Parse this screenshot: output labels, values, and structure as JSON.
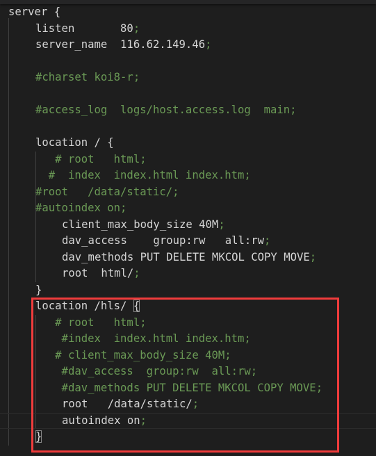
{
  "editor": {
    "language": "nginx",
    "lines": [
      {
        "indent": 0,
        "text": "server {",
        "type": "code"
      },
      {
        "indent": 1,
        "text": "listen       80;",
        "type": "code"
      },
      {
        "indent": 1,
        "text": "server_name  116.62.149.46;",
        "type": "code"
      },
      {
        "indent": 1,
        "text": "",
        "type": "blank"
      },
      {
        "indent": 1,
        "text": "#charset koi8-r;",
        "type": "comment"
      },
      {
        "indent": 1,
        "text": "",
        "type": "blank"
      },
      {
        "indent": 1,
        "text": "#access_log  logs/host.access.log  main;",
        "type": "comment"
      },
      {
        "indent": 1,
        "text": "",
        "type": "blank"
      },
      {
        "indent": 1,
        "text": "location / {",
        "type": "code"
      },
      {
        "indent": 1,
        "text": "   # root   html;",
        "type": "comment"
      },
      {
        "indent": 1,
        "text": "  #  index  index.html index.htm;",
        "type": "comment"
      },
      {
        "indent": 1,
        "text": "#root   /data/static/;",
        "type": "comment"
      },
      {
        "indent": 1,
        "text": "#autoindex on;",
        "type": "comment"
      },
      {
        "indent": 2,
        "text": "client_max_body_size 40M;",
        "type": "code"
      },
      {
        "indent": 2,
        "text": "dav_access    group:rw   all:rw;",
        "type": "code"
      },
      {
        "indent": 2,
        "text": "dav_methods PUT DELETE MKCOL COPY MOVE;",
        "type": "code"
      },
      {
        "indent": 2,
        "text": "root  html/;",
        "type": "code"
      },
      {
        "indent": 1,
        "text": "}",
        "type": "code"
      },
      {
        "indent": 1,
        "text": "location /hls/ {",
        "type": "code"
      },
      {
        "indent": 1,
        "text": "   # root   html;",
        "type": "comment"
      },
      {
        "indent": 1,
        "text": "    #index  index.html index.htm;",
        "type": "comment"
      },
      {
        "indent": 1,
        "text": "   # client_max_body_size 40M;",
        "type": "comment"
      },
      {
        "indent": 1,
        "text": "    #dav_access  group:rw  all:rw;",
        "type": "comment"
      },
      {
        "indent": 1,
        "text": "    #dav_methods PUT DELETE MKCOL COPY MOVE;",
        "type": "comment"
      },
      {
        "indent": 2,
        "text": "root   /data/static/;",
        "type": "code"
      },
      {
        "indent": 2,
        "text": "autoindex on;",
        "type": "code"
      },
      {
        "indent": 1,
        "text": "}",
        "type": "code"
      }
    ],
    "current_line": 25,
    "highlight_color": "#f03c3c",
    "comment_color": "#6a9955",
    "text_color": "#d4d4d4",
    "background": "#1e1e1e"
  }
}
